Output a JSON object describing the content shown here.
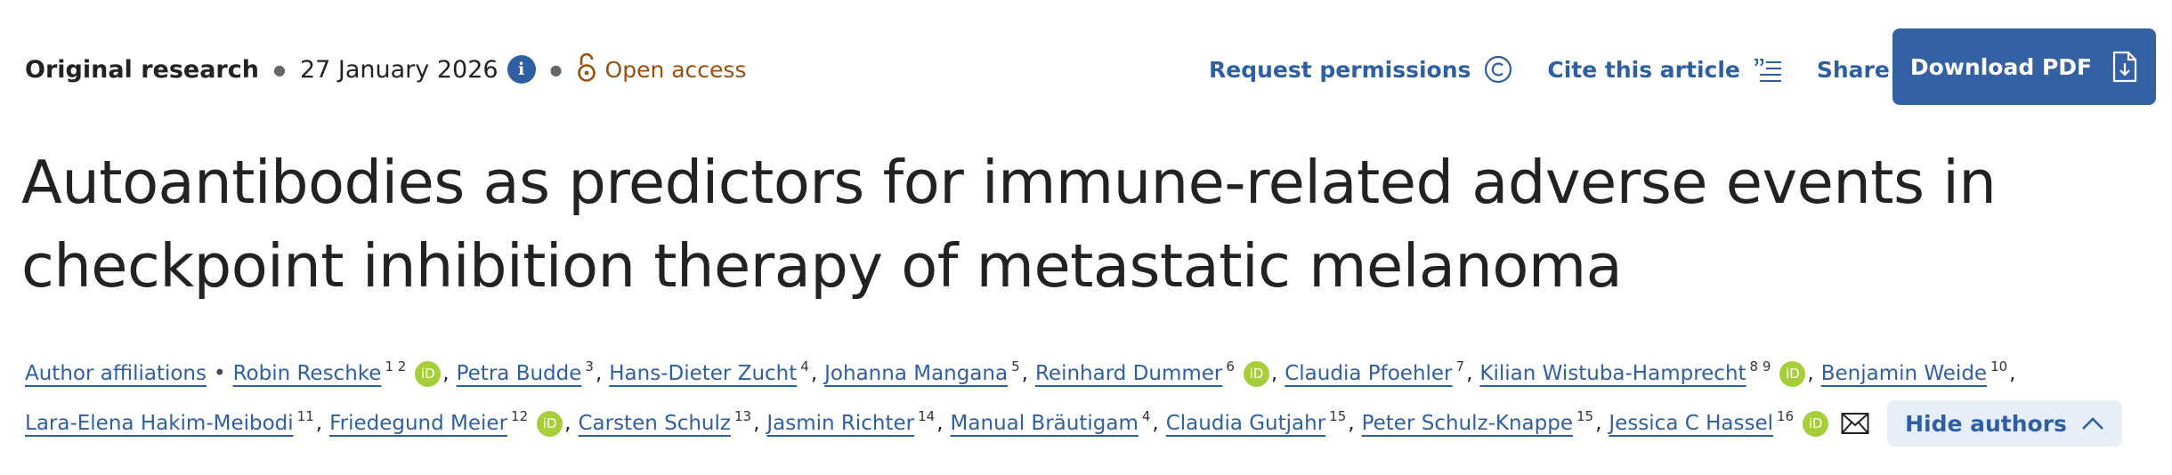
{
  "header": {
    "article_type": "Original research",
    "date": "27 January 2026",
    "info_symbol": "i",
    "open_access": "Open access"
  },
  "actions": {
    "request_permissions": "Request permissions",
    "cite": "Cite this article",
    "share": "Share",
    "download_pdf": "Download PDF"
  },
  "title": "Autoantibodies as predictors for immune-related adverse events in checkpoint inhibition therapy of metastatic melanoma",
  "authors": {
    "affiliations_label": "Author affiliations",
    "hide_label": "Hide authors",
    "orcid_label": "iD",
    "list": [
      {
        "name": "Robin Reschke",
        "sup": "1 2",
        "orcid": true
      },
      {
        "name": "Petra Budde",
        "sup": "3",
        "orcid": false
      },
      {
        "name": "Hans-Dieter Zucht",
        "sup": "4",
        "orcid": false
      },
      {
        "name": "Johanna Mangana",
        "sup": "5",
        "orcid": false
      },
      {
        "name": "Reinhard Dummer",
        "sup": "6",
        "orcid": true
      },
      {
        "name": "Claudia Pfoehler",
        "sup": "7",
        "orcid": false
      },
      {
        "name": "Kilian Wistuba-Hamprecht",
        "sup": "8 9",
        "orcid": true
      },
      {
        "name": "Benjamin Weide",
        "sup": "10",
        "orcid": false
      },
      {
        "name": "Lara-Elena Hakim-Meibodi",
        "sup": "11",
        "orcid": false
      },
      {
        "name": "Friedegund Meier",
        "sup": "12",
        "orcid": true
      },
      {
        "name": "Carsten Schulz",
        "sup": "13",
        "orcid": false
      },
      {
        "name": "Jasmin Richter",
        "sup": "14",
        "orcid": false
      },
      {
        "name": "Manual Bräutigam",
        "sup": "4",
        "orcid": false
      },
      {
        "name": "Claudia Gutjahr",
        "sup": "15",
        "orcid": false
      },
      {
        "name": "Peter Schulz-Knappe",
        "sup": "15",
        "orcid": false
      },
      {
        "name": "Jessica C Hassel",
        "sup": "16",
        "orcid": true
      }
    ]
  },
  "colors": {
    "link": "#2f5fa3",
    "open_access": "#9a4f0d",
    "button": "#3461a4",
    "orcid": "#a6ce39",
    "hide_bg": "#e8eef7"
  },
  "icons": {
    "info": "info-circle-icon",
    "open_access": "open-lock-icon",
    "permissions": "copyright-icon",
    "cite": "quote-list-icon",
    "share": "share-icon",
    "pdf": "file-download-icon",
    "email": "envelope-icon",
    "hide": "chevron-up-icon",
    "orcid": "orcid-icon"
  }
}
